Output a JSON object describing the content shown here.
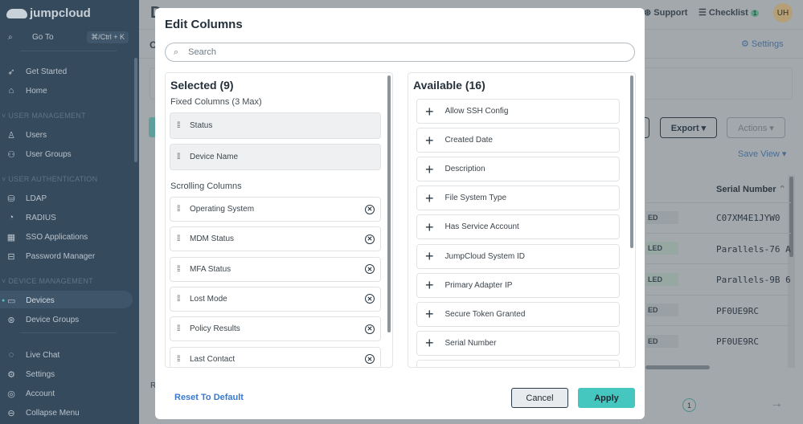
{
  "sidebar": {
    "logo": "jumpcloud",
    "goto": {
      "label": "Go To",
      "shortcut": "⌘/Ctrl + K"
    },
    "top_items": [
      {
        "label": "Get Started",
        "icon": "rocket-icon"
      },
      {
        "label": "Home",
        "icon": "home-icon"
      }
    ],
    "sections": [
      {
        "title": "USER MANAGEMENT",
        "items": [
          {
            "label": "Users"
          },
          {
            "label": "User Groups"
          }
        ]
      },
      {
        "title": "USER AUTHENTICATION",
        "items": [
          {
            "label": "LDAP"
          },
          {
            "label": "RADIUS"
          },
          {
            "label": "SSO Applications"
          },
          {
            "label": "Password Manager"
          }
        ]
      },
      {
        "title": "DEVICE MANAGEMENT",
        "items": [
          {
            "label": "Devices",
            "active": true
          },
          {
            "label": "Device Groups"
          }
        ]
      }
    ],
    "bottom_items": [
      {
        "label": "Live Chat"
      },
      {
        "label": "Settings"
      },
      {
        "label": "Account"
      },
      {
        "label": "Collapse Menu"
      }
    ]
  },
  "header": {
    "title_partial": "D",
    "tab_partial": "O",
    "support": "Support",
    "checklist": "Checklist",
    "checklist_count": "1",
    "avatar": "UH",
    "settings": "Settings"
  },
  "toolbar": {
    "export": "Export ▾",
    "actions": "Actions ▾",
    "save_view": "Save View ▾"
  },
  "table": {
    "column": "Serial Number",
    "rows": [
      {
        "status": "ED",
        "serial": "C07XM4E1JYW0"
      },
      {
        "status": "LED",
        "serial": "Parallels-76 A"
      },
      {
        "status": "LED",
        "serial": "Parallels-9B 6"
      },
      {
        "status": "ED",
        "serial": "PF0UE9RC"
      },
      {
        "status": "ED",
        "serial": "PF0UE9RC"
      }
    ]
  },
  "pagination": {
    "page": "1",
    "footer_partial": "R"
  },
  "modal": {
    "title": "Edit Columns",
    "search_placeholder": "Search",
    "selected": {
      "title": "Selected (9)",
      "fixed_label": "Fixed Columns (3 Max)",
      "fixed": [
        "Status",
        "Device Name"
      ],
      "scrolling_label": "Scrolling Columns",
      "scrolling": [
        "Operating System",
        "MDM Status",
        "MFA Status",
        "Lost Mode",
        "Policy Results",
        "Last Contact"
      ]
    },
    "available": {
      "title": "Available (16)",
      "items": [
        "Allow SSH Config",
        "Created Date",
        "Description",
        "File System Type",
        "Has Service Account",
        "JumpCloud System ID",
        "Primary Adapter IP",
        "Secure Token Granted",
        "Serial Number"
      ]
    },
    "reset": "Reset To Default",
    "cancel": "Cancel",
    "apply": "Apply"
  },
  "colors": {
    "sidebar": "#354a5d",
    "accent": "#45c7bf",
    "link": "#3a78c9"
  }
}
